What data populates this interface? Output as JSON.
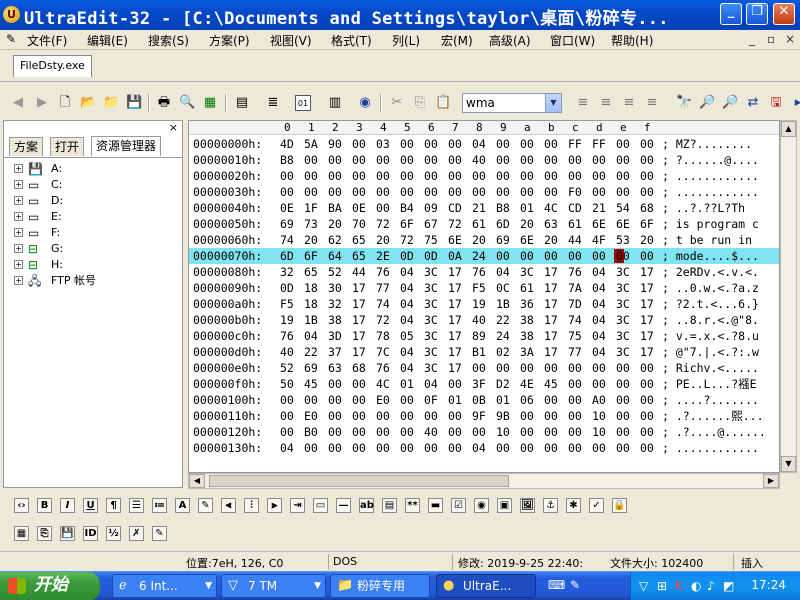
{
  "window": {
    "title": "UltraEdit-32 - [C:\\Documents and Settings\\taylor\\桌面\\粉碎专...",
    "app_icon": "ultraedit-icon",
    "minimize_icon": "minimize-icon",
    "maximize_icon": "restore-icon",
    "close_icon": "close-icon"
  },
  "menu": {
    "items": [
      "文件(F)",
      "编辑(E)",
      "搜索(S)",
      "方案(P)",
      "视图(V)",
      "格式(T)",
      "列(L)",
      "宏(M)",
      "高级(A)",
      "窗口(W)",
      "帮助(H)"
    ],
    "mdi_buttons": [
      "_",
      "▫",
      "×"
    ]
  },
  "file_tab": {
    "label": "FileDsty.exe"
  },
  "toolbar": {
    "combo_value": "wma"
  },
  "left_panel": {
    "close": "×",
    "tabs": [
      "方案",
      "打开",
      "资源管理器"
    ],
    "active_tab": 2,
    "tree": [
      {
        "label": "A:",
        "icon": "floppy-icon"
      },
      {
        "label": "C:",
        "icon": "drive-icon"
      },
      {
        "label": "D:",
        "icon": "drive-icon"
      },
      {
        "label": "E:",
        "icon": "drive-icon"
      },
      {
        "label": "F:",
        "icon": "drive-icon"
      },
      {
        "label": "G:",
        "icon": "network-drive-icon"
      },
      {
        "label": "H:",
        "icon": "network-drive-icon"
      },
      {
        "label": "FTP 帐号",
        "icon": "ftp-icon"
      }
    ]
  },
  "hex": {
    "header": [
      "0",
      "1",
      "2",
      "3",
      "4",
      "5",
      "6",
      "7",
      "8",
      "9",
      "a",
      "b",
      "c",
      "d",
      "e",
      "f"
    ],
    "highlighted_row": 7,
    "cursor_col": 14,
    "rows": [
      {
        "addr": "00000000h:",
        "bytes": [
          "4D",
          "5A",
          "90",
          "00",
          "03",
          "00",
          "00",
          "00",
          "04",
          "00",
          "00",
          "00",
          "FF",
          "FF",
          "00",
          "00"
        ],
        "ascii": "; MZ?........"
      },
      {
        "addr": "00000010h:",
        "bytes": [
          "B8",
          "00",
          "00",
          "00",
          "00",
          "00",
          "00",
          "00",
          "40",
          "00",
          "00",
          "00",
          "00",
          "00",
          "00",
          "00"
        ],
        "ascii": "; ?......@...."
      },
      {
        "addr": "00000020h:",
        "bytes": [
          "00",
          "00",
          "00",
          "00",
          "00",
          "00",
          "00",
          "00",
          "00",
          "00",
          "00",
          "00",
          "00",
          "00",
          "00",
          "00"
        ],
        "ascii": "; ............"
      },
      {
        "addr": "00000030h:",
        "bytes": [
          "00",
          "00",
          "00",
          "00",
          "00",
          "00",
          "00",
          "00",
          "00",
          "00",
          "00",
          "00",
          "F0",
          "00",
          "00",
          "00"
        ],
        "ascii": "; ............"
      },
      {
        "addr": "00000040h:",
        "bytes": [
          "0E",
          "1F",
          "BA",
          "0E",
          "00",
          "B4",
          "09",
          "CD",
          "21",
          "B8",
          "01",
          "4C",
          "CD",
          "21",
          "54",
          "68"
        ],
        "ascii": "; ..?.??L?Th"
      },
      {
        "addr": "00000050h:",
        "bytes": [
          "69",
          "73",
          "20",
          "70",
          "72",
          "6F",
          "67",
          "72",
          "61",
          "6D",
          "20",
          "63",
          "61",
          "6E",
          "6E",
          "6F"
        ],
        "ascii": "; is program c"
      },
      {
        "addr": "00000060h:",
        "bytes": [
          "74",
          "20",
          "62",
          "65",
          "20",
          "72",
          "75",
          "6E",
          "20",
          "69",
          "6E",
          "20",
          "44",
          "4F",
          "53",
          "20"
        ],
        "ascii": "; t be run in"
      },
      {
        "addr": "00000070h:",
        "bytes": [
          "6D",
          "6F",
          "64",
          "65",
          "2E",
          "0D",
          "0D",
          "0A",
          "24",
          "00",
          "00",
          "00",
          "00",
          "00",
          "00",
          "00"
        ],
        "ascii": "; mode....$..."
      },
      {
        "addr": "00000080h:",
        "bytes": [
          "32",
          "65",
          "52",
          "44",
          "76",
          "04",
          "3C",
          "17",
          "76",
          "04",
          "3C",
          "17",
          "76",
          "04",
          "3C",
          "17"
        ],
        "ascii": "; 2eRDv.<.v.<."
      },
      {
        "addr": "00000090h:",
        "bytes": [
          "0D",
          "18",
          "30",
          "17",
          "77",
          "04",
          "3C",
          "17",
          "F5",
          "0C",
          "61",
          "17",
          "7A",
          "04",
          "3C",
          "17"
        ],
        "ascii": "; ..0.w.<.?a.z"
      },
      {
        "addr": "000000a0h:",
        "bytes": [
          "F5",
          "18",
          "32",
          "17",
          "74",
          "04",
          "3C",
          "17",
          "19",
          "1B",
          "36",
          "17",
          "7D",
          "04",
          "3C",
          "17"
        ],
        "ascii": "; ?2.t.<...6.}"
      },
      {
        "addr": "000000b0h:",
        "bytes": [
          "19",
          "1B",
          "38",
          "17",
          "72",
          "04",
          "3C",
          "17",
          "40",
          "22",
          "38",
          "17",
          "74",
          "04",
          "3C",
          "17"
        ],
        "ascii": "; ..8.r.<.@\"8."
      },
      {
        "addr": "000000c0h:",
        "bytes": [
          "76",
          "04",
          "3D",
          "17",
          "78",
          "05",
          "3C",
          "17",
          "89",
          "24",
          "38",
          "17",
          "75",
          "04",
          "3C",
          "17"
        ],
        "ascii": "; v.=.x.<.?8.u"
      },
      {
        "addr": "000000d0h:",
        "bytes": [
          "40",
          "22",
          "37",
          "17",
          "7C",
          "04",
          "3C",
          "17",
          "B1",
          "02",
          "3A",
          "17",
          "77",
          "04",
          "3C",
          "17"
        ],
        "ascii": "; @\"7.|.<.?:.w"
      },
      {
        "addr": "000000e0h:",
        "bytes": [
          "52",
          "69",
          "63",
          "68",
          "76",
          "04",
          "3C",
          "17",
          "00",
          "00",
          "00",
          "00",
          "00",
          "00",
          "00",
          "00"
        ],
        "ascii": "; Richv.<....."
      },
      {
        "addr": "000000f0h:",
        "bytes": [
          "50",
          "45",
          "00",
          "00",
          "4C",
          "01",
          "04",
          "00",
          "3F",
          "D2",
          "4E",
          "45",
          "00",
          "00",
          "00",
          "00"
        ],
        "ascii": "; PE..L...?襁E"
      },
      {
        "addr": "00000100h:",
        "bytes": [
          "00",
          "00",
          "00",
          "00",
          "E0",
          "00",
          "0F",
          "01",
          "0B",
          "01",
          "06",
          "00",
          "00",
          "A0",
          "00",
          "00"
        ],
        "ascii": "; ....?......."
      },
      {
        "addr": "00000110h:",
        "bytes": [
          "00",
          "E0",
          "00",
          "00",
          "00",
          "00",
          "00",
          "00",
          "9F",
          "9B",
          "00",
          "00",
          "00",
          "10",
          "00",
          "00"
        ],
        "ascii": "; .?......熙..."
      },
      {
        "addr": "00000120h:",
        "bytes": [
          "00",
          "B0",
          "00",
          "00",
          "00",
          "00",
          "40",
          "00",
          "00",
          "10",
          "00",
          "00",
          "00",
          "10",
          "00",
          "00"
        ],
        "ascii": "; .?....@......"
      },
      {
        "addr": "00000130h:",
        "bytes": [
          "04",
          "00",
          "00",
          "00",
          "00",
          "00",
          "00",
          "00",
          "04",
          "00",
          "00",
          "00",
          "00",
          "00",
          "00",
          "00"
        ],
        "ascii": "; ............"
      }
    ]
  },
  "status": {
    "position": "位置:7eH, 126, C0",
    "format": "DOS",
    "modified": "修改: 2019-9-25 22:40:",
    "size": "文件大小: 102400",
    "mode": "插入"
  },
  "taskbar": {
    "start_label": "开始",
    "tasks": [
      {
        "label": "6 Int...",
        "icon": "ie-icon",
        "arrow": "▼"
      },
      {
        "label": "7 TM",
        "icon": "tm-icon",
        "arrow": "▼"
      },
      {
        "label": "粉碎专用",
        "icon": "folder-icon",
        "arrow": ""
      },
      {
        "label": "UltraE...",
        "icon": "ultraedit-icon",
        "arrow": ""
      }
    ],
    "clock": "17:24"
  }
}
